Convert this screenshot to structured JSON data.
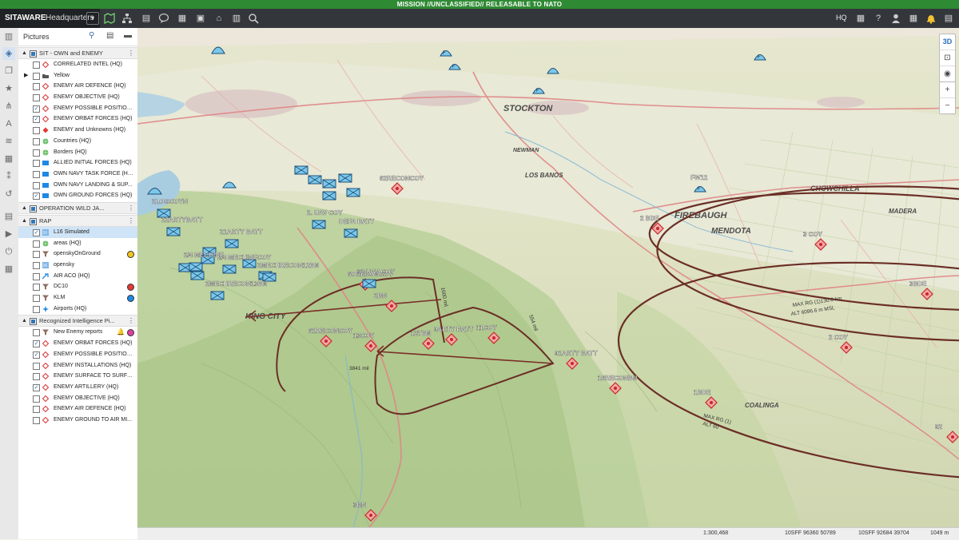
{
  "banner": "MISSION //UNCLASSIFIED// RELEASABLE TO NATO",
  "app": {
    "brand": "SITAWARE",
    "product": "Headquarters",
    "hq": "HQ"
  },
  "panel": {
    "title": "Pictures",
    "groups": [
      {
        "label": "SIT - OWN and ENEMY",
        "items": [
          {
            "label": "CORRELATED INTEL (HQ)",
            "checked": false,
            "icon": "diamond-outline-red"
          },
          {
            "label": "Yellow",
            "checked": false,
            "icon": "folder",
            "expander": true
          },
          {
            "label": "ENEMY AIR DEFENCE (HQ)",
            "checked": false,
            "icon": "diamond-outline-red"
          },
          {
            "label": "ENEMY OBJECTIVE (HQ)",
            "checked": false,
            "icon": "diamond-outline-red"
          },
          {
            "label": "ENEMY POSSIBLE POSITION...",
            "checked": true,
            "icon": "diamond-outline-red"
          },
          {
            "label": "ENEMY ORBAT FORCES (HQ)",
            "checked": true,
            "icon": "diamond-outline-red"
          },
          {
            "label": "ENEMY and Unknowns (HQ)",
            "checked": false,
            "icon": "diamond-red"
          },
          {
            "label": "Countries (HQ)",
            "checked": false,
            "icon": "globe-green"
          },
          {
            "label": "Borders (HQ)",
            "checked": false,
            "icon": "globe-green"
          },
          {
            "label": "ALLIED INITIAL FORCES (HQ)",
            "checked": false,
            "icon": "rect-blue"
          },
          {
            "label": "OWN NAVY TASK FORCE (HQ)",
            "checked": false,
            "icon": "rect-blue"
          },
          {
            "label": "OWN NAVY LANDING & SUP...",
            "checked": false,
            "icon": "rect-blue"
          },
          {
            "label": "OWN GROUND FORCES (HQ)",
            "checked": true,
            "icon": "rect-blue"
          }
        ]
      },
      {
        "label": "OPERATION WILD JA...",
        "items": []
      },
      {
        "label": "RAP",
        "items": [
          {
            "label": "L16 Simulated",
            "checked": true,
            "icon": "l16",
            "selected": true
          },
          {
            "label": "areas (HQ)",
            "checked": false,
            "icon": "globe-green"
          },
          {
            "label": "openskyOnGround",
            "checked": false,
            "icon": "funnel",
            "dot": "#f3c41b"
          },
          {
            "label": "opensky",
            "checked": false,
            "icon": "l16"
          },
          {
            "label": "AIR ACO (HQ)",
            "checked": false,
            "icon": "arrow-blue"
          },
          {
            "label": "DC10",
            "checked": false,
            "icon": "funnel",
            "dot": "#e53935"
          },
          {
            "label": "KLM",
            "checked": false,
            "icon": "funnel",
            "dot": "#1e88e5"
          },
          {
            "label": "Airports (HQ)",
            "checked": false,
            "icon": "plane-blue"
          }
        ]
      },
      {
        "label": "Recognized Intelligence Pi...",
        "items": [
          {
            "label": "New Enemy reports",
            "checked": false,
            "icon": "funnel",
            "bell": true,
            "dot": "#e040a0"
          },
          {
            "label": "ENEMY ORBAT FORCES (HQ)",
            "checked": true,
            "icon": "diamond-outline-red"
          },
          {
            "label": "ENEMY POSSIBLE POSITION...",
            "checked": true,
            "icon": "diamond-outline-red"
          },
          {
            "label": "ENEMY INSTALLATIONS (HQ)",
            "checked": false,
            "icon": "diamond-outline-red"
          },
          {
            "label": "ENEMY SURFACE TO SURFA...",
            "checked": false,
            "icon": "diamond-outline-red"
          },
          {
            "label": "ENEMY ARTILLERY (HQ)",
            "checked": true,
            "icon": "diamond-outline-red"
          },
          {
            "label": "ENEMY OBJECTIVE (HQ)",
            "checked": false,
            "icon": "diamond-outline-red"
          },
          {
            "label": "ENEMY AIR DEFENCE (HQ)",
            "checked": false,
            "icon": "diamond-outline-red"
          },
          {
            "label": "ENEMY GROUND TO AIR MI...",
            "checked": false,
            "icon": "diamond-outline-red"
          }
        ]
      }
    ]
  },
  "map_labels": {
    "places": [
      "STOCKTON",
      "LOS BANOS",
      "CHOWCHILLA",
      "FIREBAUGH",
      "MENDOTA",
      "KING CITY",
      "COALINGA",
      "NEWMAN",
      "MADERA"
    ],
    "enemy_units": [
      "62RECONCOY",
      "2 BDE",
      "3 COY",
      "6ORECONCOY",
      "2BN",
      "61RECONCOY",
      "13COY",
      "12TBN",
      "9ARTY BATT",
      "11COY",
      "91ARTY BATT",
      "16RECONBN",
      "2 COY",
      "1BDE",
      "3BDE",
      "3BN",
      "92"
    ],
    "own_units": [
      "2LOGCOYN",
      "22ARTYBATT",
      "21ARTY BATT",
      "2. UAV COY",
      "DEFA BATT",
      "2/4 MECHINFCOY",
      "2/4 MECHINF",
      "2MECHRECON12BN",
      "32 UAV COY",
      "2MECHRECON13BN"
    ],
    "air": [
      "FW12"
    ],
    "range_labels": [
      "MAX RG (1)130.0 km",
      "ALT 6096.6 m MSL",
      "MAX RG (1)",
      "ALT 60",
      "554 mil",
      "1600 mil",
      "3841 mil"
    ]
  },
  "controls": {
    "mode_3d": "3D"
  },
  "status": {
    "scale": "1:300,468",
    "coord1": "10SFF 96360 50789",
    "coord2": "10SFF 92684 39704",
    "elev": "1049 m"
  }
}
